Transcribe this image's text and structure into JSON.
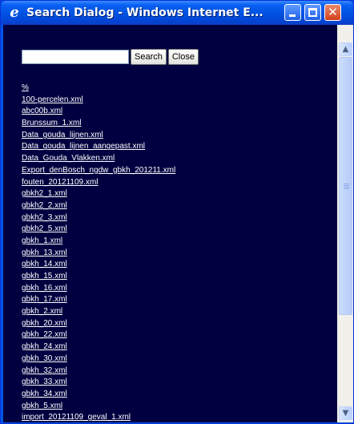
{
  "window": {
    "title": "Search Dialog - Windows Internet E...",
    "icon": "internet-explorer-icon",
    "controls": {
      "minimize": "minimize-icon",
      "maximize": "maximize-icon",
      "close_glyph": "✕"
    }
  },
  "search": {
    "value": "",
    "search_label": "Search",
    "close_label": "Close"
  },
  "results": [
    "%",
    "100-percelen.xml",
    "abc00b.xml",
    "Brunssum_1.xml",
    "Data_gouda_lijnen.xml",
    "Data_gouda_lijnen_aangepast.xml",
    "Data_Gouda_Vlakken.xml",
    "Export_denBosch_ngdw_gbkh_201211.xml",
    "fouten_20121109.xml",
    "gbkh2_1.xml",
    "gbkh2_2.xml",
    "gbkh2_3.xml",
    "gbkh2_5.xml",
    "gbkh_1.xml",
    "gbkh_13.xml",
    "gbkh_14.xml",
    "gbkh_15.xml",
    "gbkh_16.xml",
    "gbkh_17.xml",
    "gbkh_2.xml",
    "gbkh_20.xml",
    "gbkh_22.xml",
    "gbkh_24.xml",
    "gbkh_30.xml",
    "gbkh_32.xml",
    "gbkh_33.xml",
    "gbkh_34.xml",
    "gbkh_5.xml",
    "import_20121109_geval_1.xml"
  ],
  "scrollbar": {
    "up": "▲",
    "down": "▼",
    "position": 0.0,
    "visible_fraction": 0.72
  },
  "colors": {
    "content_bg": "#000040",
    "link": "#ffffff",
    "titlebar": "#0054e3"
  }
}
